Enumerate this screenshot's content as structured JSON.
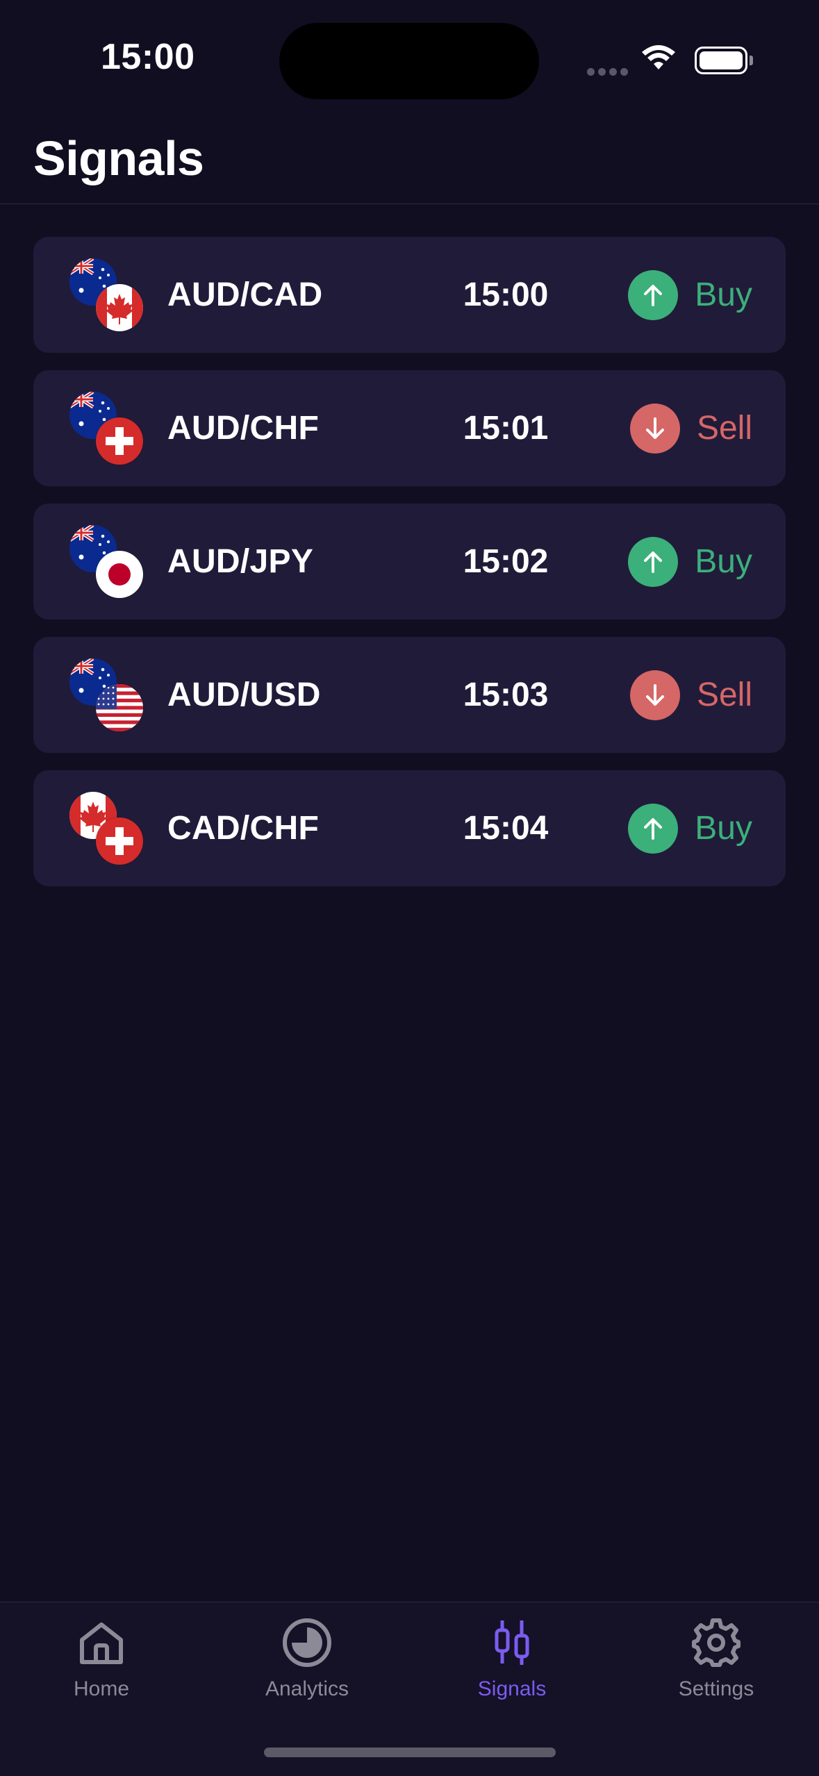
{
  "status_bar": {
    "time": "15:00"
  },
  "header": {
    "title": "Signals"
  },
  "signals": [
    {
      "pair": "AUD/CAD",
      "time": "15:00",
      "direction": "Buy",
      "base_flag": "australia-flag",
      "quote_flag": "canada-flag"
    },
    {
      "pair": "AUD/CHF",
      "time": "15:01",
      "direction": "Sell",
      "base_flag": "australia-flag",
      "quote_flag": "switzerland-flag"
    },
    {
      "pair": "AUD/JPY",
      "time": "15:02",
      "direction": "Buy",
      "base_flag": "australia-flag",
      "quote_flag": "japan-flag"
    },
    {
      "pair": "AUD/USD",
      "time": "15:03",
      "direction": "Sell",
      "base_flag": "australia-flag",
      "quote_flag": "usa-flag"
    },
    {
      "pair": "CAD/CHF",
      "time": "15:04",
      "direction": "Buy",
      "base_flag": "canada-flag",
      "quote_flag": "switzerland-flag"
    }
  ],
  "tabs": [
    {
      "label": "Home",
      "icon": "home-icon",
      "active": false
    },
    {
      "label": "Analytics",
      "icon": "analytics-icon",
      "active": false
    },
    {
      "label": "Signals",
      "icon": "candlestick-icon",
      "active": true
    },
    {
      "label": "Settings",
      "icon": "gear-icon",
      "active": false
    }
  ],
  "colors": {
    "background": "#120e21",
    "card": "#211b3a",
    "buy": "#3bb07a",
    "sell": "#d56766",
    "accent": "#7b5cf0",
    "tab_inactive": "#8d8a98"
  }
}
